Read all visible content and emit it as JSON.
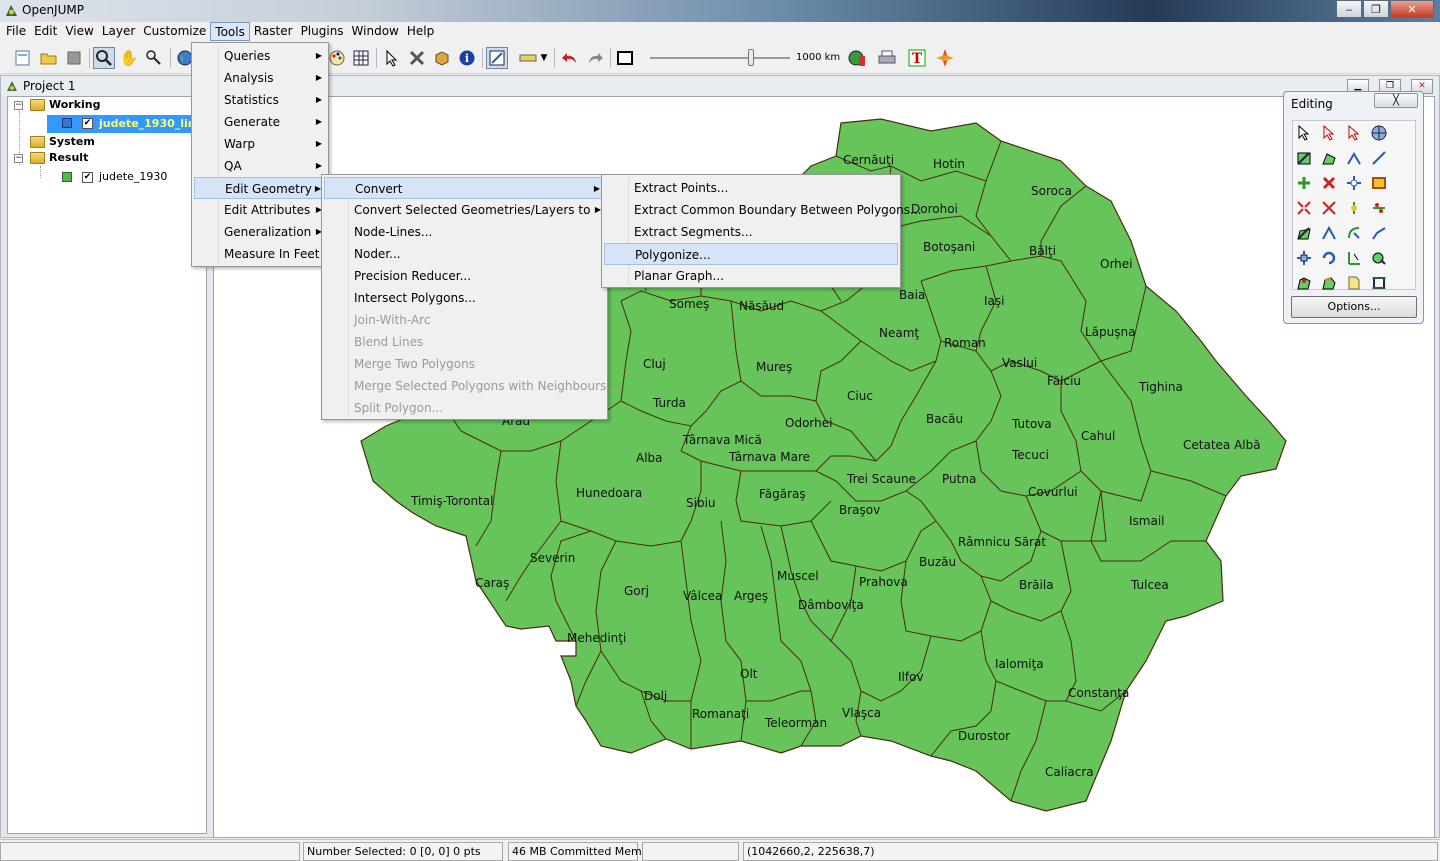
{
  "window": {
    "title": "OpenJUMP",
    "minimize": "‒",
    "maximize": "❐",
    "close": "✕"
  },
  "menubar": [
    "File",
    "Edit",
    "View",
    "Layer",
    "Customize",
    "Tools",
    "Raster",
    "Plugins",
    "Window",
    "Help"
  ],
  "toolbar": {
    "scale_label": "1000 km"
  },
  "project": {
    "title": "Project 1"
  },
  "layer_tree": {
    "working": "Working",
    "working_layer": "judete_1930_lin",
    "system": "System",
    "result": "Result",
    "result_layer": "judete_1930",
    "colors": {
      "working_swatch": "#3a78c6",
      "result_swatch": "#52b848",
      "selection": "#3399ff",
      "selected_text": "#ffff66"
    }
  },
  "tools_menu": [
    {
      "label": "Queries",
      "submenu": true
    },
    {
      "label": "Analysis",
      "submenu": true
    },
    {
      "label": "Statistics",
      "submenu": true
    },
    {
      "label": "Generate",
      "submenu": true
    },
    {
      "label": "Warp",
      "submenu": true
    },
    {
      "label": "QA",
      "submenu": true
    },
    {
      "label": "Edit Geometry",
      "submenu": true,
      "highlighted": true
    },
    {
      "label": "Edit Attributes",
      "submenu": true
    },
    {
      "label": "Generalization",
      "submenu": true
    },
    {
      "label": "Measure In Feet",
      "submenu": false
    }
  ],
  "edit_geometry_menu": [
    {
      "label": "Convert",
      "submenu": true,
      "highlighted": true
    },
    {
      "label": "Convert Selected Geometries/Layers to",
      "submenu": true
    },
    {
      "label": "Node-Lines...",
      "enabled": true
    },
    {
      "label": "Noder...",
      "enabled": true
    },
    {
      "label": "Precision Reducer...",
      "enabled": true
    },
    {
      "label": "Intersect Polygons...",
      "enabled": true
    },
    {
      "label": "Join-With-Arc",
      "enabled": false
    },
    {
      "label": "Blend Lines",
      "enabled": false
    },
    {
      "label": "Merge Two Polygons",
      "enabled": false
    },
    {
      "label": "Merge Selected Polygons with Neighbours...",
      "enabled": false
    },
    {
      "label": "Split Polygon...",
      "enabled": false
    }
  ],
  "convert_menu": [
    {
      "label": "Extract Points..."
    },
    {
      "label": "Extract Common Boundary Between Polygons..."
    },
    {
      "label": "Extract Segments..."
    },
    {
      "label": "Polygonize...",
      "highlighted": true
    },
    {
      "label": "Planar Graph..."
    }
  ],
  "editing_palette": {
    "title": "Editing",
    "close": "╳",
    "options": "Options..."
  },
  "map": {
    "fill": "#66c45a",
    "stroke": "#4a2a12",
    "labels": [
      "Cernăuţi",
      "Hotin",
      "Soroca",
      "Dorohoi",
      "Botoşani",
      "Bălţi",
      "Orhei",
      "Baia",
      "Iaşi",
      "Lăpuşna",
      "Someş",
      "Năsăud",
      "Neamţ",
      "Roman",
      "Vaslui",
      "Fălciu",
      "Tighina",
      "Cluj",
      "Mureş",
      "Ciuc",
      "Bacău",
      "Turda",
      "Odorhei",
      "Tutova",
      "Cahul",
      "Cetatea Albă",
      "Arad",
      "Târnava Mică",
      "Alba",
      "Târnava Mare",
      "Tecuci",
      "Timiş-Torontal",
      "Hunedoara",
      "Sibiu",
      "Făgăraş",
      "Trei Scaune",
      "Putna",
      "Covurlui",
      "Braşov",
      "Râmnicu Sărat",
      "Ismail",
      "Severin",
      "Buzău",
      "Caraş",
      "Gorj",
      "Muscel",
      "Prahova",
      "Brăila",
      "Tulcea",
      "Vâlcea",
      "Argeş",
      "Dâmboviţa",
      "Mehedinţi",
      "Ialomiţa",
      "Olt",
      "Ilfov",
      "Constanţa",
      "Dolj",
      "Romanaţi",
      "Teleorman",
      "Vlaşca",
      "Durostor",
      "Caliacra"
    ]
  },
  "statusbar": {
    "selection": "Number Selected: 0 [0, 0] 0 pts",
    "memory": "46 MB Committed Memory",
    "coords": "(1042660,2, 225638,7)"
  }
}
